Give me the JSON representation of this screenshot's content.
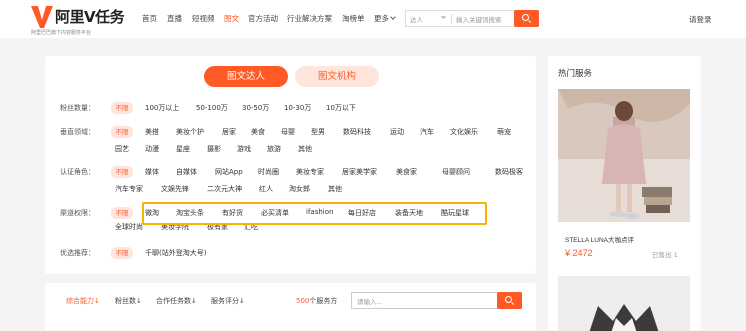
{
  "header": {
    "logo": {
      "name": "阿里V任务",
      "sub": "阿里巴巴旗下内容服务平台"
    },
    "nav": [
      "首页",
      "直播",
      "短视频",
      "图文",
      "官方活动",
      "行业解决方案",
      "淘榜单",
      "更多"
    ],
    "nav_active": "图文",
    "search": {
      "select": "达人",
      "placeholder": "输入关键词搜索"
    },
    "login": "请登录"
  },
  "tabs": [
    "图文达人",
    "图文机构"
  ],
  "filters": {
    "fans": {
      "label": "粉丝数量：",
      "unlimited": "不限",
      "options": [
        "100万以上",
        "50-100万",
        "30-50万",
        "10-30万",
        "10万以下"
      ]
    },
    "vertical": {
      "label": "垂直领域：",
      "unlimited": "不限",
      "row1": [
        "美搭",
        "美妆个护",
        "居家",
        "美食",
        "母婴",
        "型男",
        "数码科技",
        "运动",
        "汽车",
        "文化娱乐",
        "萌宠"
      ],
      "row2": [
        "园艺",
        "动漫",
        "星座",
        "摄影",
        "游戏",
        "旅游",
        "其他"
      ]
    },
    "cert": {
      "label": "认证角色：",
      "unlimited": "不限",
      "row1": [
        "媒体",
        "自媒体",
        "网站App",
        "时尚圈",
        "美妆专家",
        "居家美学家",
        "美食家",
        "母婴顾问",
        "数码极客"
      ],
      "row2": [
        "汽车专家",
        "文娱先锋",
        "二次元大神",
        "红人",
        "淘女郎",
        "其他"
      ]
    },
    "channel": {
      "label": "渠道权限：",
      "unlimited": "不限",
      "row1": [
        "微淘",
        "淘宝头条",
        "有好货",
        "必买清单",
        "ifashion",
        "每日好店",
        "装备天地",
        "酷玩星球"
      ],
      "row2": [
        "全球时尚",
        "美妆学院",
        "极有家",
        "汇吃"
      ]
    },
    "priority": {
      "label": "优选推荐：",
      "unlimited": "不限",
      "options": [
        "千聊(站外登淘大号)"
      ]
    }
  },
  "sortbar": {
    "sorts": [
      "综合能力",
      "粉丝数",
      "合作任务数",
      "服务评分"
    ],
    "count": "500",
    "count_suffix": "个服务方",
    "placeholder": "请输入..."
  },
  "side": {
    "title": "热门服务",
    "item_name": "STELLA LUNA大咖点评",
    "price": "¥ 2472",
    "sold": "已售出 1"
  },
  "colors": {
    "accent": "#ff5a26",
    "highlight": "#f5b400",
    "tag_bg": "#ffe3dc"
  }
}
